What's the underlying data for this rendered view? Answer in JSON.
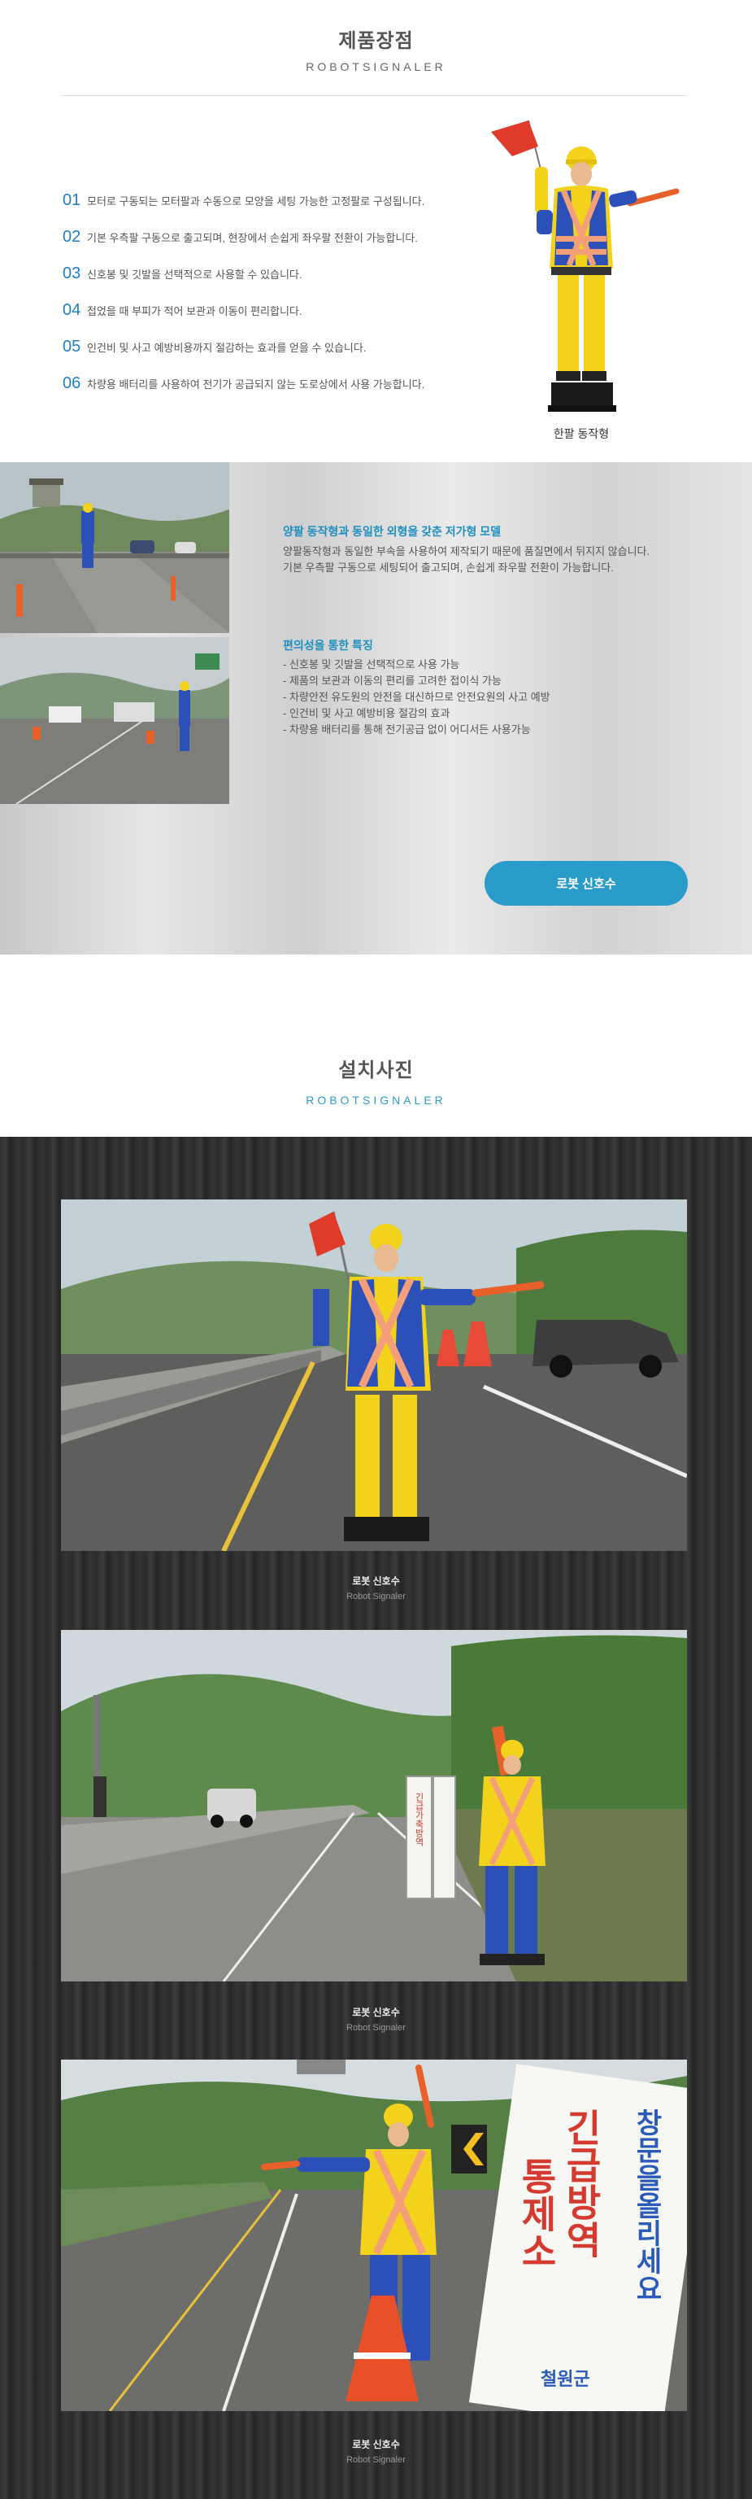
{
  "features_section": {
    "title": "제품장점",
    "subtitle": "ROBOTSIGNALER",
    "items": [
      {
        "num": "01",
        "text": "모터로 구동되는 모터팔과 수동으로 모양을 세팅 가능한 고정팔로 구성됩니다."
      },
      {
        "num": "02",
        "text": "기본 우측팔 구동으로 출고되며, 현장에서 손쉽게 좌우팔 전환이 가능합니다."
      },
      {
        "num": "03",
        "text": "신호봉 및 깃발을 선택적으로 사용할 수 있습니다."
      },
      {
        "num": "04",
        "text": "접었을 때 부피가 적어 보관과 이동이 편리합니다."
      },
      {
        "num": "05",
        "text": "인건비 및 사고 예방비용까지 절감하는 효과를 얻을 수 있습니다."
      },
      {
        "num": "06",
        "text": "차량용 배터리를 사용하여 전기가 공급되지 않는 도로상에서 사용 가능합니다."
      }
    ],
    "robot_caption": "한팔 동작형"
  },
  "model_section": {
    "model_title": "양팔 동작형과 동일한 외형을 갖춘 저가형 모델",
    "model_desc_1": "양팔동작형과 동일한 부속을 사용하여 제작되기 때문에 품질면에서 뒤지지 않습니다.",
    "model_desc_2": "기본 우측팔 구동으로 세팅되어 출고되며, 손쉽게 좌우팔 전환이 가능합니다.",
    "conv_title": "편의성을 통한 특징",
    "conv_items": [
      "- 신호봉 및 깃발을 선택적으로 사용 가능",
      "- 제품의 보관과 이동의 편리를 고려한 접이식 가능",
      "- 차량안전 유도원의 안전을 대신하므로 안전요원의 사고 예방",
      "- 인건비 및 사고 예방비용 절감의 효과",
      "- 차량용 배터리를 통해 전기공급 없이 어디서든 사용가능"
    ],
    "button_label": "로봇 신호수"
  },
  "install_section": {
    "title": "설치사진",
    "subtitle": "ROBOTSIGNALER"
  },
  "gallery": [
    {
      "caption_ko": "로봇 신호수",
      "caption_en": "Robot Signaler"
    },
    {
      "caption_ko": "로봇 신호수",
      "caption_en": "Robot Signaler"
    },
    {
      "caption_ko": "로봇 신호수",
      "caption_en": "Robot Signaler"
    }
  ],
  "signs": {
    "sign2_main": "긴급가축방역",
    "sign3_main_1": "긴급방역",
    "sign3_main_2": "통제소",
    "sign3_top": "창문을올리세요",
    "sign3_bottom": "철원군"
  },
  "colors": {
    "accent": "#2a9cc9",
    "number_blue": "#1f7fc4",
    "robot_yellow": "#f2d21b",
    "robot_blue": "#2c4fb8"
  }
}
